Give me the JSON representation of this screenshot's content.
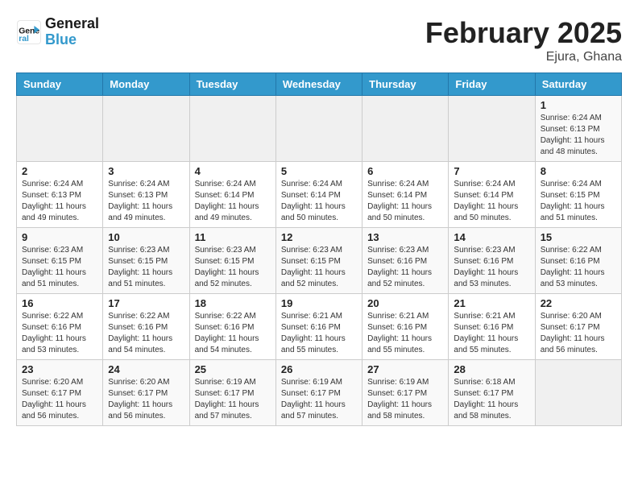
{
  "header": {
    "logo_line1": "General",
    "logo_line2": "Blue",
    "month_title": "February 2025",
    "location": "Ejura, Ghana"
  },
  "weekdays": [
    "Sunday",
    "Monday",
    "Tuesday",
    "Wednesday",
    "Thursday",
    "Friday",
    "Saturday"
  ],
  "weeks": [
    [
      {
        "day": "",
        "info": ""
      },
      {
        "day": "",
        "info": ""
      },
      {
        "day": "",
        "info": ""
      },
      {
        "day": "",
        "info": ""
      },
      {
        "day": "",
        "info": ""
      },
      {
        "day": "",
        "info": ""
      },
      {
        "day": "1",
        "info": "Sunrise: 6:24 AM\nSunset: 6:13 PM\nDaylight: 11 hours and 48 minutes."
      }
    ],
    [
      {
        "day": "2",
        "info": "Sunrise: 6:24 AM\nSunset: 6:13 PM\nDaylight: 11 hours and 49 minutes."
      },
      {
        "day": "3",
        "info": "Sunrise: 6:24 AM\nSunset: 6:13 PM\nDaylight: 11 hours and 49 minutes."
      },
      {
        "day": "4",
        "info": "Sunrise: 6:24 AM\nSunset: 6:14 PM\nDaylight: 11 hours and 49 minutes."
      },
      {
        "day": "5",
        "info": "Sunrise: 6:24 AM\nSunset: 6:14 PM\nDaylight: 11 hours and 50 minutes."
      },
      {
        "day": "6",
        "info": "Sunrise: 6:24 AM\nSunset: 6:14 PM\nDaylight: 11 hours and 50 minutes."
      },
      {
        "day": "7",
        "info": "Sunrise: 6:24 AM\nSunset: 6:14 PM\nDaylight: 11 hours and 50 minutes."
      },
      {
        "day": "8",
        "info": "Sunrise: 6:24 AM\nSunset: 6:15 PM\nDaylight: 11 hours and 51 minutes."
      }
    ],
    [
      {
        "day": "9",
        "info": "Sunrise: 6:23 AM\nSunset: 6:15 PM\nDaylight: 11 hours and 51 minutes."
      },
      {
        "day": "10",
        "info": "Sunrise: 6:23 AM\nSunset: 6:15 PM\nDaylight: 11 hours and 51 minutes."
      },
      {
        "day": "11",
        "info": "Sunrise: 6:23 AM\nSunset: 6:15 PM\nDaylight: 11 hours and 52 minutes."
      },
      {
        "day": "12",
        "info": "Sunrise: 6:23 AM\nSunset: 6:15 PM\nDaylight: 11 hours and 52 minutes."
      },
      {
        "day": "13",
        "info": "Sunrise: 6:23 AM\nSunset: 6:16 PM\nDaylight: 11 hours and 52 minutes."
      },
      {
        "day": "14",
        "info": "Sunrise: 6:23 AM\nSunset: 6:16 PM\nDaylight: 11 hours and 53 minutes."
      },
      {
        "day": "15",
        "info": "Sunrise: 6:22 AM\nSunset: 6:16 PM\nDaylight: 11 hours and 53 minutes."
      }
    ],
    [
      {
        "day": "16",
        "info": "Sunrise: 6:22 AM\nSunset: 6:16 PM\nDaylight: 11 hours and 53 minutes."
      },
      {
        "day": "17",
        "info": "Sunrise: 6:22 AM\nSunset: 6:16 PM\nDaylight: 11 hours and 54 minutes."
      },
      {
        "day": "18",
        "info": "Sunrise: 6:22 AM\nSunset: 6:16 PM\nDaylight: 11 hours and 54 minutes."
      },
      {
        "day": "19",
        "info": "Sunrise: 6:21 AM\nSunset: 6:16 PM\nDaylight: 11 hours and 55 minutes."
      },
      {
        "day": "20",
        "info": "Sunrise: 6:21 AM\nSunset: 6:16 PM\nDaylight: 11 hours and 55 minutes."
      },
      {
        "day": "21",
        "info": "Sunrise: 6:21 AM\nSunset: 6:16 PM\nDaylight: 11 hours and 55 minutes."
      },
      {
        "day": "22",
        "info": "Sunrise: 6:20 AM\nSunset: 6:17 PM\nDaylight: 11 hours and 56 minutes."
      }
    ],
    [
      {
        "day": "23",
        "info": "Sunrise: 6:20 AM\nSunset: 6:17 PM\nDaylight: 11 hours and 56 minutes."
      },
      {
        "day": "24",
        "info": "Sunrise: 6:20 AM\nSunset: 6:17 PM\nDaylight: 11 hours and 56 minutes."
      },
      {
        "day": "25",
        "info": "Sunrise: 6:19 AM\nSunset: 6:17 PM\nDaylight: 11 hours and 57 minutes."
      },
      {
        "day": "26",
        "info": "Sunrise: 6:19 AM\nSunset: 6:17 PM\nDaylight: 11 hours and 57 minutes."
      },
      {
        "day": "27",
        "info": "Sunrise: 6:19 AM\nSunset: 6:17 PM\nDaylight: 11 hours and 58 minutes."
      },
      {
        "day": "28",
        "info": "Sunrise: 6:18 AM\nSunset: 6:17 PM\nDaylight: 11 hours and 58 minutes."
      },
      {
        "day": "",
        "info": ""
      }
    ]
  ]
}
